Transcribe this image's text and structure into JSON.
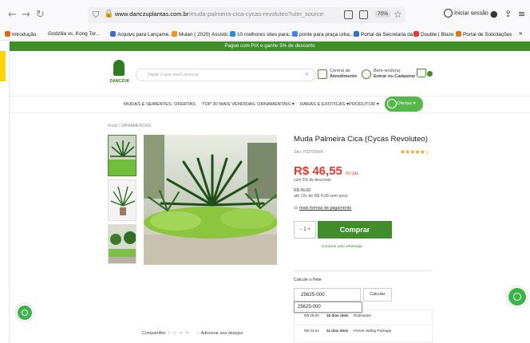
{
  "browser": {
    "url_host": "www.danczuplantas.com.br",
    "url_path": "/muda-palmeira-cica-cycas-revoluteo?utm_source=Site&utm_medium=Cl",
    "zoom": "70%",
    "session_label": "Iniciar sessão",
    "bookmarks": [
      "Introdução",
      "Godzilla vs. Kong Tor...",
      "Arquivo para Lançame...",
      "Mulan ( 2020) Assistir...",
      "10 melhores sites para...",
      "ponte para praça urba...",
      "Portal da Secretaria da...",
      "Double | Blaze",
      "Portal de Solicitações"
    ],
    "bookmark_colors": [
      "#e06a1b",
      "#3c6ed8",
      "#2d6ad0",
      "#e59a1a",
      "#2b8ed6",
      "#4285f4",
      "#2e72c8",
      "#e03a3a",
      "#e0781a"
    ]
  },
  "site": {
    "promo": "Pague com PIX e ganhe 5% de desconto",
    "logo_text": "DANCZUK",
    "search_placeholder": "Digite o que você procura",
    "contact_line1": "Central de",
    "contact_line2": "Atendimento",
    "account_line1": "Bem-vindo(a)",
    "account_line2": "Entrar ou Cadastrar",
    "menu": [
      "MUDAS E SEMENTES",
      "OFERTAS",
      "TOP 30 MAIS VENDIDAS",
      "ORNAMENTAIS",
      "RARAS E EXÓTICAS",
      "PRODUTOR"
    ],
    "ofertas_button": "Ofertas"
  },
  "product": {
    "breadcrumb": "Início  /  ORNAMENTAIS",
    "title": "Muda Palmeira Cica (Cycas Revoluteo)",
    "sku": "Sku: P32789HK",
    "rating_stars": "★★★★★",
    "rating_count": "1",
    "price": "R$ 46,55",
    "price_suffix": "no pix",
    "discount_note": "com 5% de desconto",
    "old_price": "R$ 49,00",
    "installments": "até 12x de R$ 4,08 sem juros",
    "more_payment": "mais formas de pagamento",
    "quantity": "1",
    "buy_button": "Comprar",
    "whatsapp_buy": "Comprar pelo whatsapp",
    "share_label": "Compartilhe:",
    "wishlist_label": "Adicionar aos desejos"
  },
  "shipping": {
    "label": "Calcule o frete",
    "cep_value": "25625-000",
    "calc_button": "Calcular",
    "autocomplete_suggestion": "25625-000",
    "rows": [
      {
        "price": "R$ 29,00",
        "days": "16 dias úteis",
        "carrier": "Rodoviário"
      },
      {
        "price": "R$ 34,53",
        "days": "11 dias úteis",
        "carrier": "Frenet Jadlog Package"
      }
    ]
  },
  "colors": {
    "brand_green": "#3f8e2a",
    "price_red": "#e23b2b",
    "whatsapp": "#3bb54a"
  }
}
